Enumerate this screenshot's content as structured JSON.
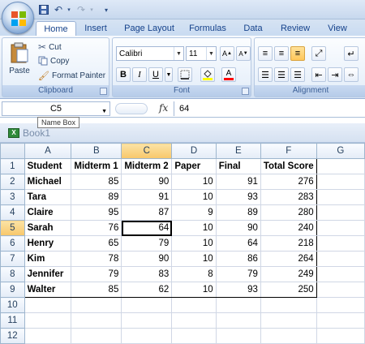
{
  "ribbon_tabs": [
    "Home",
    "Insert",
    "Page Layout",
    "Formulas",
    "Data",
    "Review",
    "View"
  ],
  "clipboard": {
    "paste": "Paste",
    "cut": "Cut",
    "copy": "Copy",
    "format_painter": "Format Painter",
    "label": "Clipboard"
  },
  "font": {
    "name": "Calibri",
    "size": "11",
    "label": "Font",
    "bold": "B",
    "italic": "I",
    "underline": "U",
    "font_color": "A"
  },
  "alignment": {
    "label": "Alignment"
  },
  "name_box": {
    "value": "C5",
    "tooltip": "Name Box"
  },
  "formula": {
    "fx": "fx",
    "value": "64"
  },
  "workbook": {
    "title": "Book1"
  },
  "columns": [
    "A",
    "B",
    "C",
    "D",
    "E",
    "F",
    "G"
  ],
  "rows": [
    [
      "Student",
      "Midterm 1",
      "Midterm 2",
      "Paper",
      "Final",
      "Total Score",
      ""
    ],
    [
      "Michael",
      "85",
      "90",
      "10",
      "91",
      "276",
      ""
    ],
    [
      "Tara",
      "89",
      "91",
      "10",
      "93",
      "283",
      ""
    ],
    [
      "Claire",
      "95",
      "87",
      "9",
      "89",
      "280",
      ""
    ],
    [
      "Sarah",
      "76",
      "64",
      "10",
      "90",
      "240",
      ""
    ],
    [
      "Henry",
      "65",
      "79",
      "10",
      "64",
      "218",
      ""
    ],
    [
      "Kim",
      "78",
      "90",
      "10",
      "86",
      "264",
      ""
    ],
    [
      "Jennifer",
      "79",
      "83",
      "8",
      "79",
      "249",
      ""
    ],
    [
      "Walter",
      "85",
      "62",
      "10",
      "93",
      "250",
      ""
    ],
    [
      "",
      "",
      "",
      "",
      "",
      "",
      ""
    ],
    [
      "",
      "",
      "",
      "",
      "",
      "",
      ""
    ],
    [
      "",
      "",
      "",
      "",
      "",
      "",
      ""
    ]
  ],
  "selected_cell": {
    "row": 5,
    "col": "C"
  },
  "colors": {
    "selection_header": "#f8c76a",
    "ribbon_blue": "#15428b"
  }
}
